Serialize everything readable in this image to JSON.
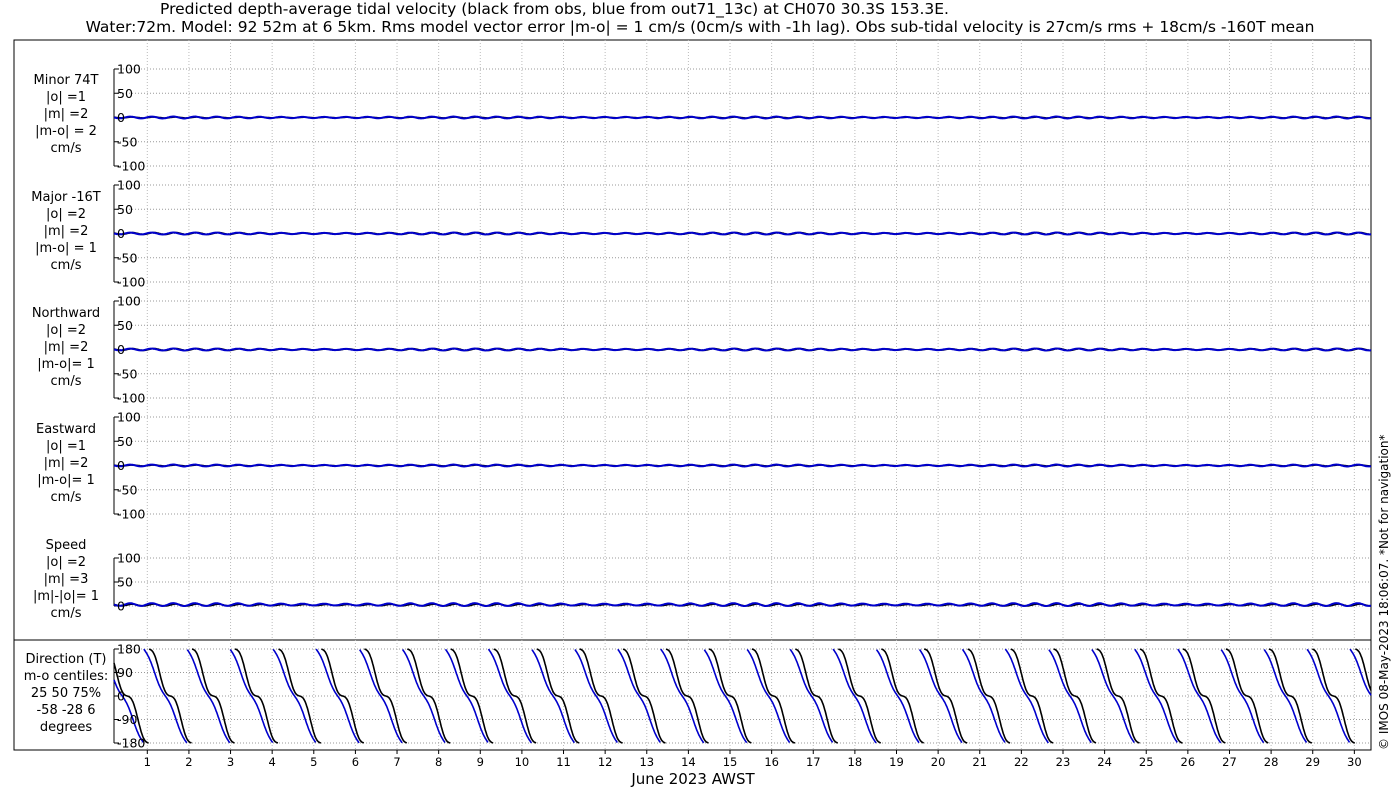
{
  "title": "Predicted depth-average tidal velocity (black from obs, blue from out71_13c) at CH070 30.3S 153.3E.",
  "subtitle": "Water:72m. Model: 92 52m at 6 5km. Rms model vector error |m-o| = 1 cm/s (0cm/s with -1h lag). Obs sub-tidal velocity is 27cm/s rms + 18cm/s -160T mean",
  "xlabel": "June 2023 AWST",
  "copyright": "© IMOS 08-May-2023 18:06:07.  *Not for navigation*",
  "colors": {
    "obs": "#000000",
    "model": "#0000cc",
    "grid": "#999999"
  },
  "x_ticks": [
    "1",
    "2",
    "3",
    "4",
    "5",
    "6",
    "7",
    "8",
    "9",
    "10",
    "11",
    "12",
    "13",
    "14",
    "15",
    "16",
    "17",
    "18",
    "19",
    "20",
    "21",
    "22",
    "23",
    "24",
    "25",
    "26",
    "27",
    "28",
    "29",
    "30"
  ],
  "panels": [
    {
      "id": "minor",
      "label_lines": [
        "Minor 74T",
        "|o| =1",
        "|m| =2",
        "|m-o| = 2",
        "cm/s"
      ],
      "yticks": [
        "100",
        "50",
        "0",
        "-50",
        "-100"
      ]
    },
    {
      "id": "major",
      "label_lines": [
        "Major -16T",
        "|o| =2",
        "|m| =2",
        "|m-o| = 1",
        "cm/s"
      ],
      "yticks": [
        "100",
        "50",
        "0",
        "-50",
        "-100"
      ]
    },
    {
      "id": "north",
      "label_lines": [
        "Northward",
        "|o| =2",
        "|m| =2",
        "|m-o|= 1",
        "cm/s"
      ],
      "yticks": [
        "100",
        "50",
        "0",
        "-50",
        "-100"
      ]
    },
    {
      "id": "east",
      "label_lines": [
        "Eastward",
        "|o| =1",
        "|m| =2",
        "|m-o|= 1",
        "cm/s"
      ],
      "yticks": [
        "100",
        "50",
        "0",
        "-50",
        "-100"
      ]
    },
    {
      "id": "speed",
      "label_lines": [
        "Speed",
        "|o| =2",
        "|m| =3",
        "|m|-|o|= 1",
        "cm/s"
      ],
      "yticks": [
        "100",
        "50",
        "0"
      ]
    },
    {
      "id": "direction",
      "label_lines": [
        "Direction (T)",
        "m-o centiles:",
        "25  50  75%",
        "-58 -28   6",
        "degrees"
      ],
      "yticks": [
        "180",
        "90",
        "0",
        "-90",
        "-180"
      ]
    }
  ],
  "chart_data": {
    "type": "line",
    "title": "Predicted depth-average tidal velocity (black from obs, blue from out71_13c) at CH070 30.3S 153.3E.",
    "xlabel": "June 2023 AWST",
    "x_range_days": [
      0.2,
      30.4
    ],
    "subplots": [
      {
        "name": "Minor 74T",
        "ylabel": "cm/s",
        "ylim": [
          -100,
          100
        ],
        "series": [
          {
            "name": "obs",
            "amplitude": 1,
            "mean": 0
          },
          {
            "name": "model",
            "amplitude": 2,
            "mean": 0
          }
        ]
      },
      {
        "name": "Major -16T",
        "ylabel": "cm/s",
        "ylim": [
          -100,
          100
        ],
        "series": [
          {
            "name": "obs",
            "amplitude": 2,
            "mean": 0
          },
          {
            "name": "model",
            "amplitude": 2,
            "mean": 0
          }
        ]
      },
      {
        "name": "Northward",
        "ylabel": "cm/s",
        "ylim": [
          -100,
          100
        ],
        "series": [
          {
            "name": "obs",
            "amplitude": 2,
            "mean": 0
          },
          {
            "name": "model",
            "amplitude": 2,
            "mean": 0
          }
        ]
      },
      {
        "name": "Eastward",
        "ylabel": "cm/s",
        "ylim": [
          -100,
          100
        ],
        "series": [
          {
            "name": "obs",
            "amplitude": 1,
            "mean": 0
          },
          {
            "name": "model",
            "amplitude": 2,
            "mean": 0
          }
        ]
      },
      {
        "name": "Speed",
        "ylabel": "cm/s",
        "ylim": [
          0,
          100
        ],
        "series": [
          {
            "name": "obs",
            "amplitude": 2,
            "mean": 2
          },
          {
            "name": "model",
            "amplitude": 3,
            "mean": 3
          }
        ]
      },
      {
        "name": "Direction (T)",
        "ylabel": "degrees",
        "ylim": [
          -180,
          180
        ],
        "series": [
          {
            "name": "obs",
            "period_days": 1.035
          },
          {
            "name": "model",
            "period_days": 1.035
          }
        ],
        "m_minus_o_centiles": {
          "25": -58,
          "50": -28,
          "75": 6
        }
      }
    ],
    "grid": true
  }
}
